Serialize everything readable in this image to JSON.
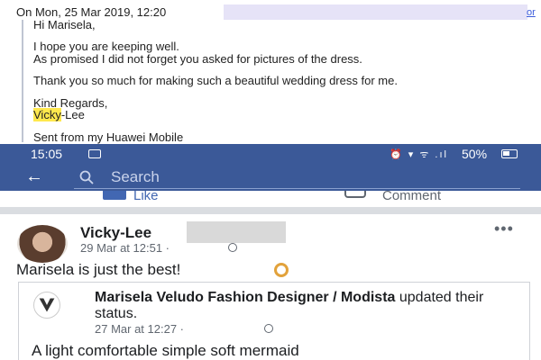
{
  "email": {
    "header": "On Mon, 25 Mar 2019, 12:20",
    "header_link": "or",
    "greeting": "Hi Marisela,",
    "line1": "I hope you are keeping well.",
    "line2": "As promised I did not forget you asked for pictures of the dress.",
    "line3": "Thank you so much for making such a beautiful wedding dress for me.",
    "signoff": "Kind Regards,",
    "signature_first": "Vicky",
    "signature_rest": "-Lee",
    "footer": "Sent from my Huawei Mobile"
  },
  "status_bar": {
    "time": "15:05",
    "icons": "⏰ ▾ ᯤ .ıl",
    "battery": "50%"
  },
  "search": {
    "back_icon": "arrow-left-icon",
    "placeholder": "Search"
  },
  "actions": {
    "like": "Like",
    "comment": "Comment"
  },
  "post": {
    "author": "Vicky-Lee",
    "time": "29 Mar at 12:51 ·",
    "more": "•••",
    "text": "Marisela is just the best!",
    "shared": {
      "page_name": "Marisela Veludo Fashion Designer / Modista",
      "action": " updated their status.",
      "time": "27 Mar at 12:27 ·",
      "text": "A light comfortable simple  soft mermaid"
    }
  },
  "colors": {
    "facebook_blue": "#3b5998",
    "highlight": "#ffe84d"
  }
}
